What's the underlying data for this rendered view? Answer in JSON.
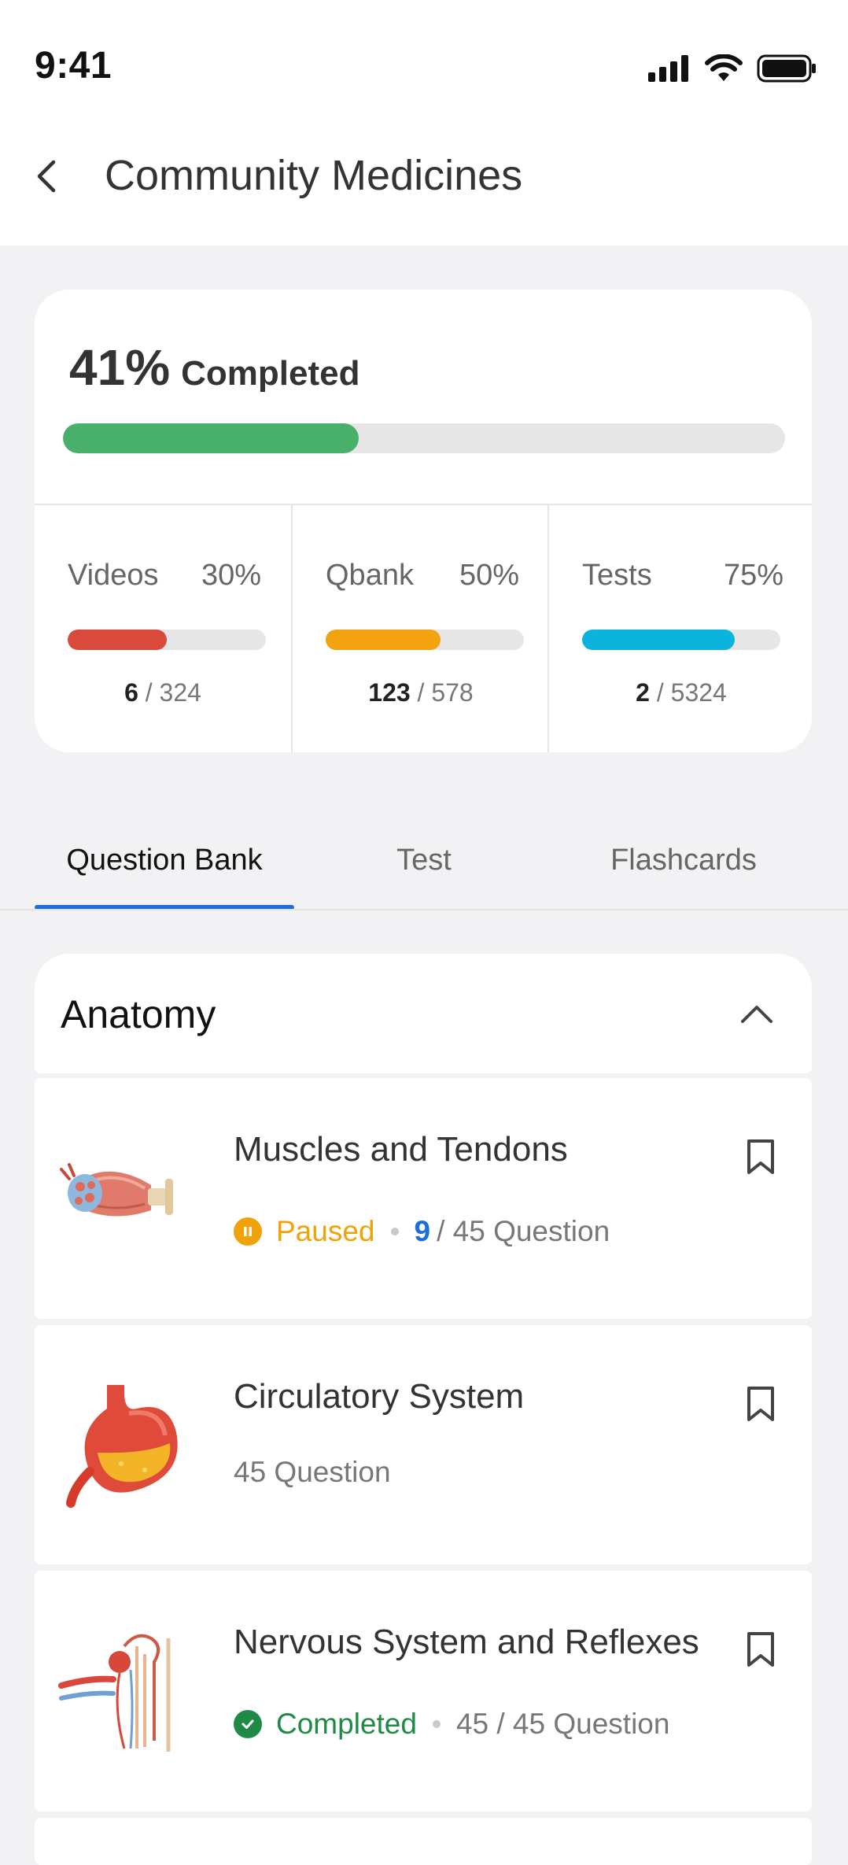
{
  "status_bar": {
    "time": "9:41"
  },
  "header": {
    "title": "Community Medicines"
  },
  "progress": {
    "overall_percent": "41%",
    "overall_fraction": 0.41,
    "completed_label": "Completed",
    "stats": [
      {
        "name": "Videos",
        "percent": "30%",
        "fraction": 0.5,
        "done": "6",
        "total": "/ 324",
        "color": "#d9493c"
      },
      {
        "name": "Qbank",
        "percent": "50%",
        "fraction": 0.58,
        "done": "123",
        "total": "/ 578",
        "color": "#f2a30f"
      },
      {
        "name": "Tests",
        "percent": "75%",
        "fraction": 0.77,
        "done": "2",
        "total": "/ 5324",
        "color": "#0ab4dc"
      }
    ],
    "overall_color": "#48b06a"
  },
  "tabs": [
    {
      "label": "Question Bank",
      "active": true
    },
    {
      "label": "Test",
      "active": false
    },
    {
      "label": "Flashcards",
      "active": false
    }
  ],
  "section": {
    "title": "Anatomy"
  },
  "items": [
    {
      "title": "Muscles and Tendons",
      "status": "Paused",
      "answered": "9",
      "questions": "/ 45 Question",
      "icon": "muscle-illustration"
    },
    {
      "title": "Circulatory System",
      "questions": "45 Question",
      "icon": "stomach-illustration"
    },
    {
      "title": "Nervous System and Reflexes",
      "status": "Completed",
      "questions": "45 / 45 Question",
      "icon": "kidney-nephron-illustration"
    }
  ]
}
